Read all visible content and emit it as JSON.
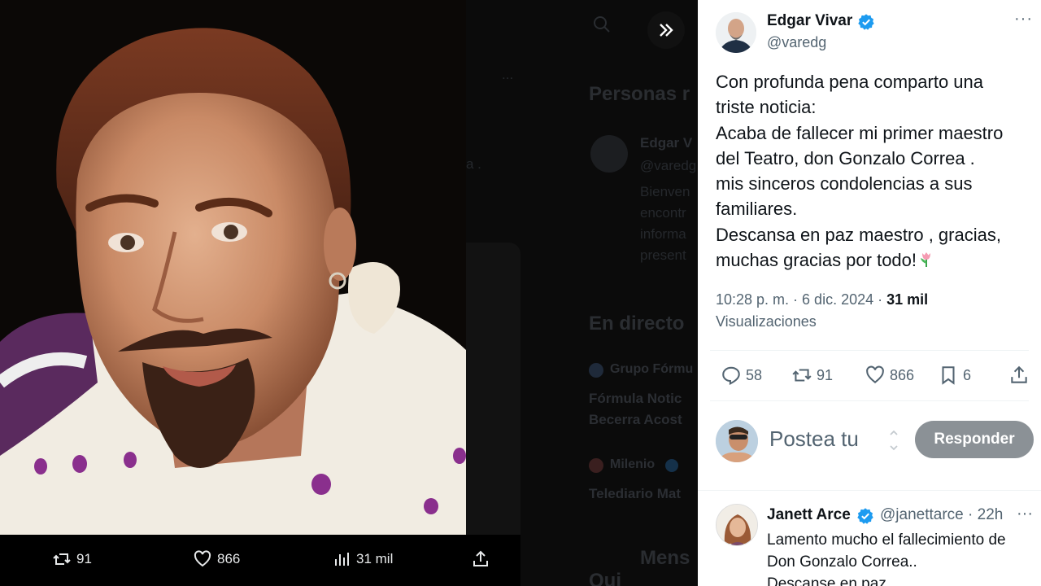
{
  "background_page": {
    "ellipsis": "...",
    "heading_people": "Personas r",
    "person_name": "Edgar V",
    "person_handle": "@varedg",
    "person_bio_lines": [
      "Bienven",
      "encontr",
      "informa",
      "present"
    ],
    "dot_text": "a .",
    "heading_live": "En directo",
    "live_source1": "Grupo Fórmu",
    "live_title1_lines": [
      "Fórmula Notic",
      "Becerra Acost"
    ],
    "live_source2": "Milenio",
    "live_title2": "Telediario Mat",
    "heading_messages": "Mens",
    "heading_who": "Qui"
  },
  "media_bar": {
    "retweets": "91",
    "likes": "866",
    "views": "31 mil"
  },
  "tweet": {
    "author_name": "Edgar Vivar",
    "author_handle": "@varedg",
    "more": "···",
    "text_lines": [
      "Con profunda pena comparto una",
      "triste noticia:",
      "Acaba de fallecer mi primer maestro",
      "del Teatro, don Gonzalo Correa .",
      "mis sinceros condolencias a sus",
      "familiares.",
      "Descansa en paz maestro , gracias,",
      "muchas gracias por todo!"
    ],
    "time": "10:28 p. m. · 6 dic. 2024 · ",
    "views_count": "31 mil",
    "views_label": "Visualizaciones",
    "replies": "58",
    "retweets": "91",
    "likes": "866",
    "bookmarks": "6"
  },
  "compose": {
    "placeholder": "Postea tu",
    "reply_button": "Responder"
  },
  "reply": {
    "name": "Janett Arce",
    "handle": "@janettarce",
    "time": "· 22h",
    "more": "···",
    "text_lines": [
      "Lamento mucho el fallecimiento de",
      "Don Gonzalo Correa..",
      "Descanse en paz."
    ]
  },
  "colors": {
    "verified": "#1d9bf0",
    "text_primary": "#0f1419",
    "text_secondary": "#536471",
    "button_disabled": "#8b9196"
  }
}
